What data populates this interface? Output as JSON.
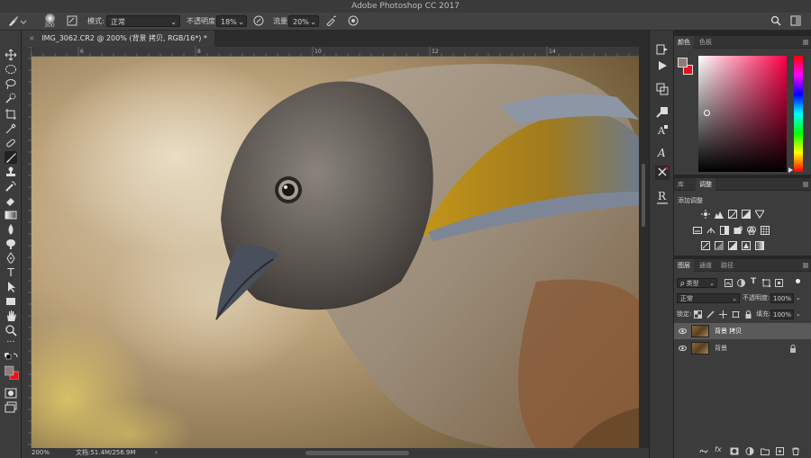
{
  "app": {
    "title": "Adobe Photoshop CC 2017"
  },
  "options": {
    "brush_size": "300",
    "mode_label": "模式:",
    "mode_value": "正常",
    "opacity_label": "不透明度:",
    "opacity_value": "18%",
    "flow_label": "流量:",
    "flow_value": "20%"
  },
  "document": {
    "tab_title": "IMG_3062.CR2 @ 200% (背景 拷贝, RGB/16*) *",
    "tab_close": "×",
    "ruler_ticks": [
      "6",
      "8",
      "10",
      "12",
      "14"
    ],
    "zoom": "200%",
    "doc_info": "文档:51.4M/256.9M",
    "status_arrow": "›"
  },
  "color_panel": {
    "tabs": [
      "颜色",
      "色板"
    ],
    "fg": "#8e7b78",
    "bg": "#e4131f"
  },
  "adjust_panel": {
    "tabs": [
      "库",
      "调整"
    ],
    "heading": "添加调整"
  },
  "layers_panel": {
    "tabs": [
      "图层",
      "通道",
      "路径"
    ],
    "filter_kind": "ρ 类型",
    "blend_mode": "正常",
    "opacity_label": "不透明度:",
    "opacity_value": "100%",
    "lock_label": "锁定:",
    "fill_label": "填充:",
    "fill_value": "100%",
    "layers": [
      {
        "name": "背景 拷贝",
        "selected": true
      },
      {
        "name": "背景",
        "selected": false
      }
    ],
    "fx_label": "fx"
  }
}
